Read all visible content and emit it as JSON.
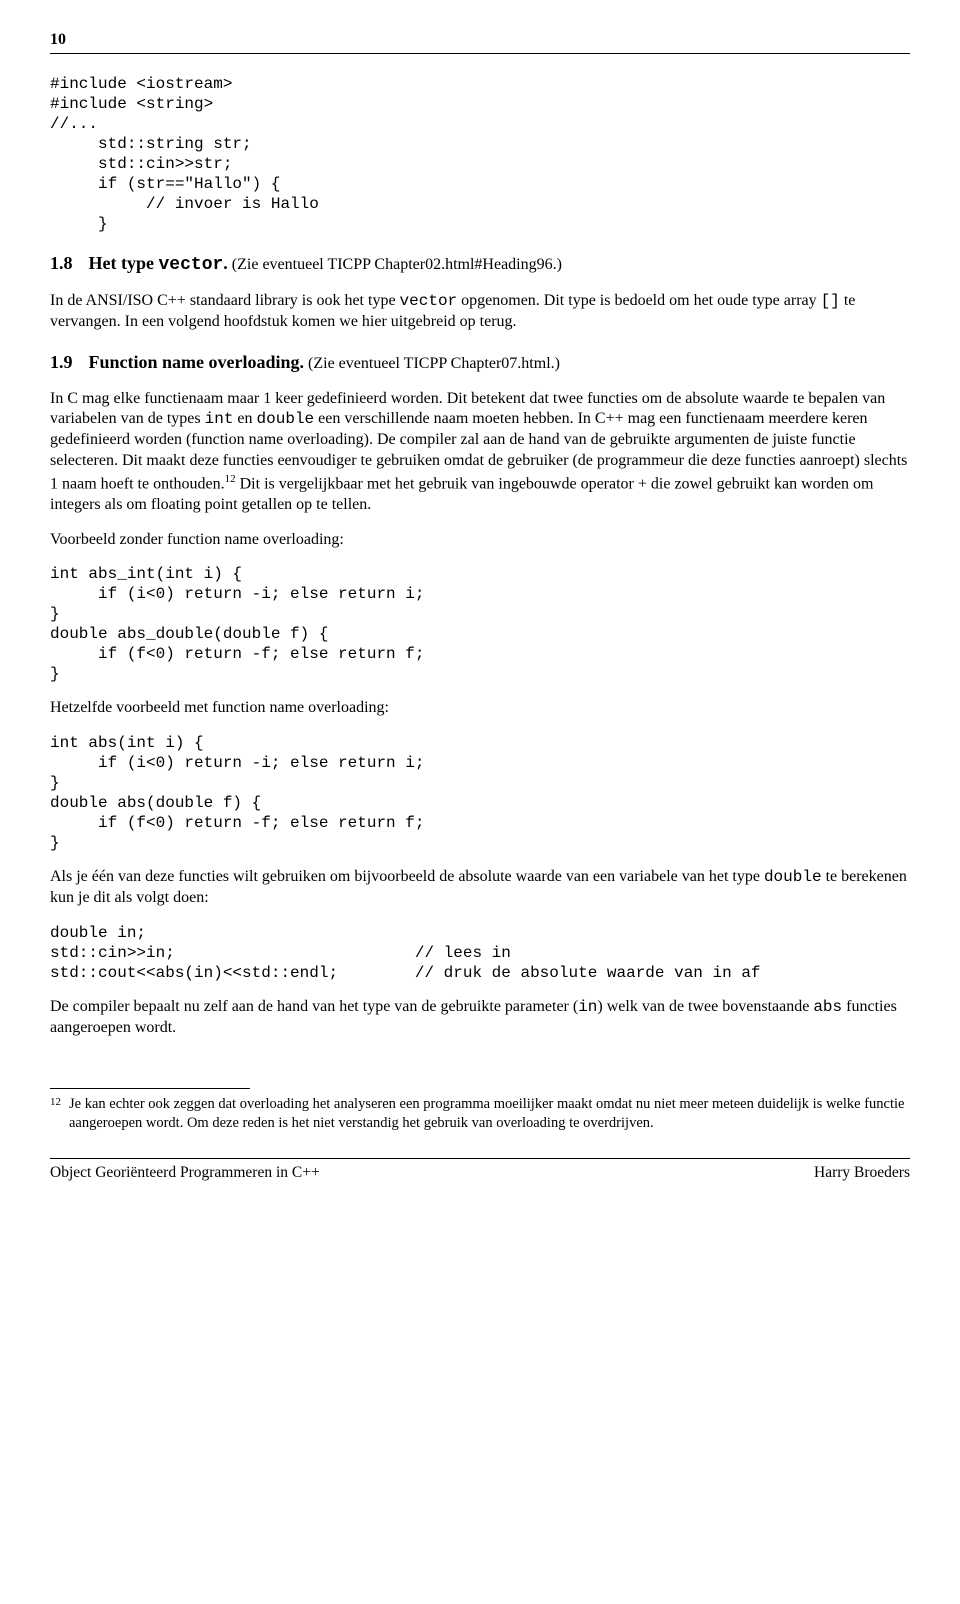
{
  "page_number": "10",
  "code1": "#include <iostream>\n#include <string>\n//...\n     std::string str;\n     std::cin>>str;\n     if (str==\"Hallo\") {\n          // invoer is Hallo\n     }",
  "section18": {
    "num": "1.8",
    "title": "Het type ",
    "title_code": "vector",
    "title_suffix": ".",
    "ref": " (Zie eventueel TICPP Chapter02.html#Heading96.)"
  },
  "para18_pre": "In de ANSI/ISO C++ standaard library is ook het type ",
  "para18_c1": "vector",
  "para18_mid1": " opgenomen. Dit type is bedoeld om het oude type array ",
  "para18_c2": "[]",
  "para18_mid2": " te vervangen. In een volgend hoofdstuk komen we hier uitgebreid op terug.",
  "section19": {
    "num": "1.9",
    "title": "Function name overloading.",
    "ref": " (Zie eventueel TICPP Chapter07.html.)"
  },
  "para19a_pre": "In C mag elke functienaam maar 1 keer gedefinieerd worden. Dit betekent dat twee functies om de absolute waarde te bepalen van variabelen van de types ",
  "para19a_c1": "int",
  "para19a_mid1": " en ",
  "para19a_c2": "double",
  "para19a_mid2": " een verschillende naam moeten hebben. In C++ mag een functienaam meerdere keren gedefinieerd worden (function name overloading). De compiler zal aan de hand van de gebruikte argumenten de juiste functie selecteren. Dit maakt deze functies eenvoudiger te gebruiken omdat de gebruiker (de programmeur die deze functies aanroept) slechts 1 naam hoeft te onthouden.",
  "fn_ref": "12",
  "para19a_tail": " Dit is vergelijkbaar met het gebruik van ingebouwde operator + die zowel gebruikt kan worden om integers als om floating point getallen op te tellen.",
  "para_vb1": "Voorbeeld zonder function name overloading:",
  "code2": "int abs_int(int i) {\n     if (i<0) return -i; else return i;\n}\ndouble abs_double(double f) {\n     if (f<0) return -f; else return f;\n}",
  "para_vb2": "Hetzelfde voorbeeld met function name overloading:",
  "code3": "int abs(int i) {\n     if (i<0) return -i; else return i;\n}\ndouble abs(double f) {\n     if (f<0) return -f; else return f;\n}",
  "para_use_pre": "Als je één van deze functies wilt gebruiken om bijvoorbeeld de absolute waarde van een variabele van het type ",
  "para_use_c1": "double",
  "para_use_mid": " te berekenen kun je dit als volgt doen:",
  "code4": "double in;\nstd::cin>>in;                         // lees in\nstd::cout<<abs(in)<<std::endl;        // druk de absolute waarde van in af",
  "para_comp_pre": "De compiler bepaalt nu zelf aan de hand van het type van de gebruikte parameter (",
  "para_comp_c1": "in",
  "para_comp_mid": ") welk van de twee bovenstaande ",
  "para_comp_c2": "abs",
  "para_comp_tail": " functies aangeroepen wordt.",
  "footnote": {
    "num": "12",
    "text": "Je kan echter ook zeggen dat overloading het analyseren een programma moeilijker maakt omdat nu niet meer meteen duidelijk is welke functie aangeroepen wordt. Om deze reden is het niet verstandig het gebruik van overloading te overdrijven."
  },
  "footer": {
    "left": "Object Georiënteerd Programmeren in C++",
    "right": "Harry Broeders"
  }
}
